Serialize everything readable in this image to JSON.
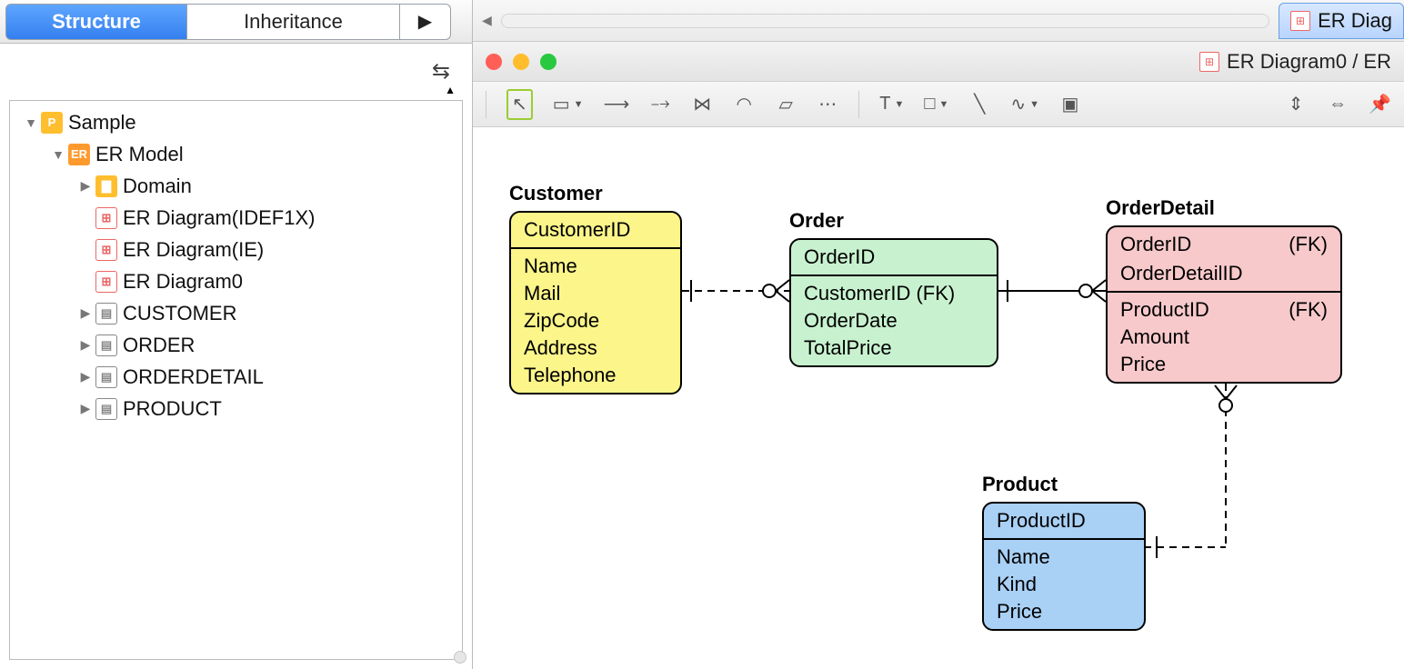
{
  "tabs": {
    "structure": "Structure",
    "inheritance": "Inheritance",
    "more": "▶"
  },
  "tree": {
    "root": "Sample",
    "model": "ER Model",
    "domain": "Domain",
    "diag_idef1x": "ER Diagram(IDEF1X)",
    "diag_ie": "ER Diagram(IE)",
    "diag0": "ER Diagram0",
    "t_customer": "CUSTOMER",
    "t_order": "ORDER",
    "t_orderdetail": "ORDERDETAIL",
    "t_product": "PRODUCT"
  },
  "top_right_tab": "ER Diag",
  "window_title": "ER Diagram0 / ER",
  "entities": {
    "customer": {
      "title": "Customer",
      "pk": "CustomerID",
      "attrs": [
        "Name",
        "Mail",
        "ZipCode",
        "Address",
        "Telephone"
      ]
    },
    "order": {
      "title": "Order",
      "pk": "OrderID",
      "attrs": [
        "CustomerID (FK)",
        "OrderDate",
        "TotalPrice"
      ]
    },
    "orderdetail": {
      "title": "OrderDetail",
      "pk1": "OrderID",
      "pk1_fk": "(FK)",
      "pk2": "OrderDetailID",
      "attr1": "ProductID",
      "attr1_fk": "(FK)",
      "attr2": "Amount",
      "attr3": "Price"
    },
    "product": {
      "title": "Product",
      "pk": "ProductID",
      "attrs": [
        "Name",
        "Kind",
        "Price"
      ]
    }
  }
}
